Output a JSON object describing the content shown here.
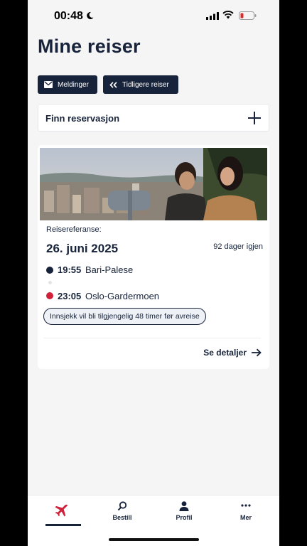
{
  "status_bar": {
    "time": "00:48",
    "icons": [
      "moon-icon",
      "signal-icon",
      "wifi-icon",
      "battery-low-icon"
    ],
    "battery_color": "#e02a2a"
  },
  "page": {
    "title": "Mine reiser"
  },
  "actions": {
    "messages_label": "Meldinger",
    "previous_trips_label": "Tidligere reiser"
  },
  "find_reservation": {
    "label": "Finn reservasjon",
    "icon": "plus-icon"
  },
  "trip": {
    "reference_label": "Reisereferanse:",
    "date": "26. juni 2025",
    "days_left": "92 dager igjen",
    "departure": {
      "time": "19:55",
      "place": "Bari-Palese"
    },
    "arrival": {
      "time": "23:05",
      "place": "Oslo-Gardermoen"
    },
    "checkin_notice": "Innsjekk vil bli tilgjengelig 48 timer før avreise",
    "details_label": "Se detaljer"
  },
  "bottom_nav": {
    "items": [
      {
        "label": "",
        "icon": "airplane-icon",
        "active": true
      },
      {
        "label": "Bestill",
        "icon": "search-icon"
      },
      {
        "label": "Profil",
        "icon": "person-icon"
      },
      {
        "label": "Mer",
        "icon": "more-dots-icon"
      }
    ]
  },
  "colors": {
    "navy": "#17233a",
    "accent_red": "#d0213a",
    "background": "#f5f5f6"
  }
}
